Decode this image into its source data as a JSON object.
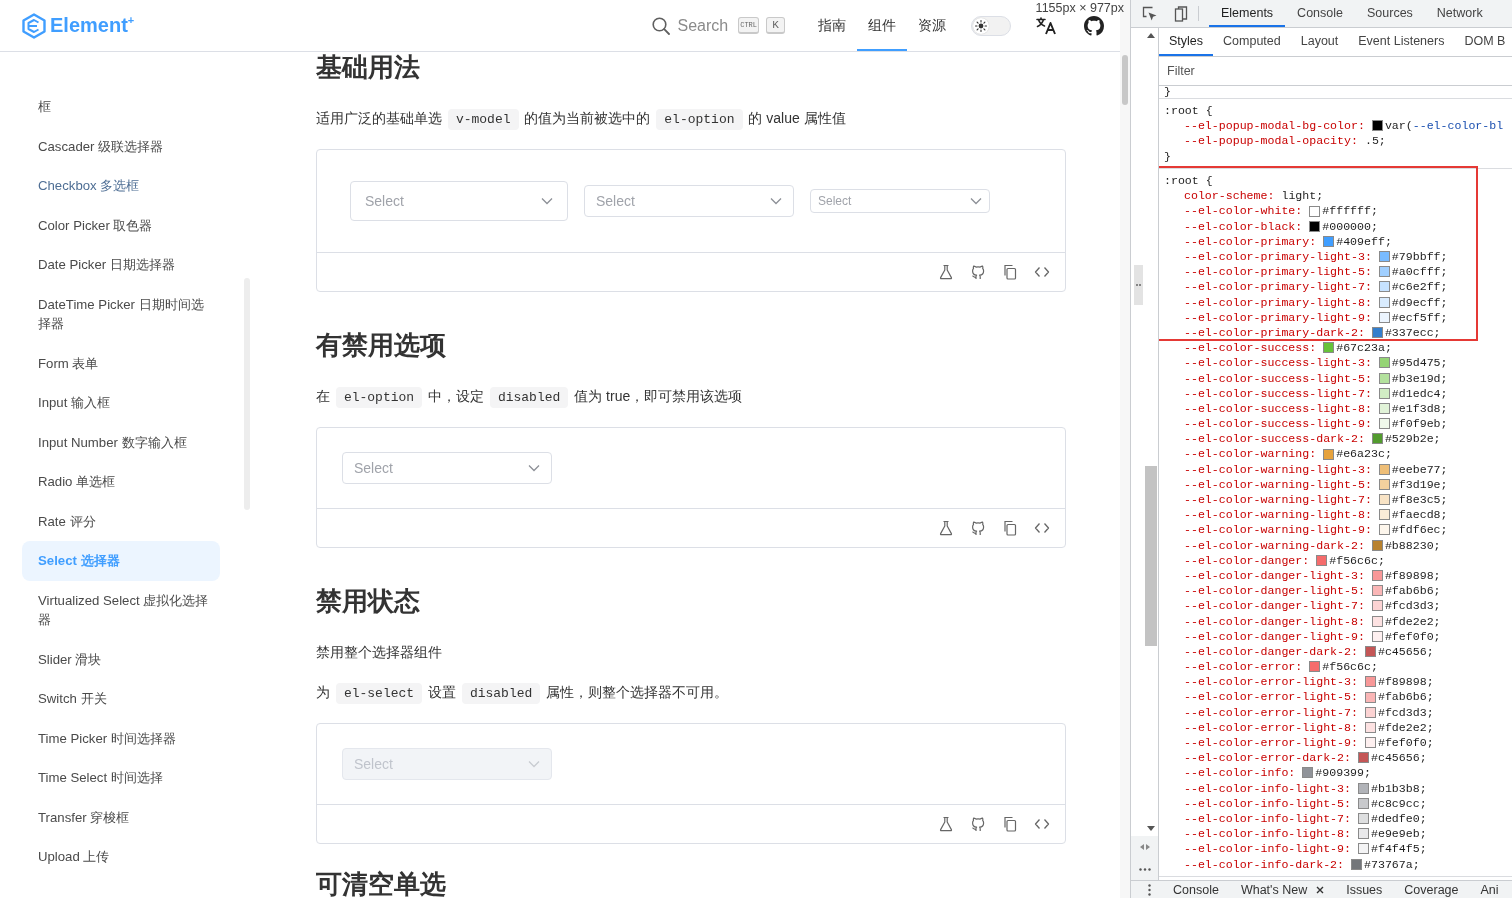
{
  "page": {
    "header": {
      "logo": "Element$^{+}$",
      "search": {
        "label": "Search",
        "keys": [
          "CTRL",
          "K"
        ]
      },
      "nav": [
        {
          "label": "指南",
          "selected": false
        },
        {
          "label": "组件",
          "selected": true
        },
        {
          "label": "资源",
          "selected": false
        }
      ],
      "theme_switch": {
        "on": false
      }
    },
    "viewport_size": "1155px × 977px",
    "sidebar": {
      "items": [
        {
          "label": "框",
          "selected": false,
          "hovered": false
        },
        {
          "label": "Cascader 级联选择器",
          "selected": false,
          "hovered": false
        },
        {
          "label": "Checkbox 多选框",
          "selected": false,
          "hovered": true
        },
        {
          "label": "Color Picker 取色器",
          "selected": false,
          "hovered": false
        },
        {
          "label": "Date Picker 日期选择器",
          "selected": false,
          "hovered": false
        },
        {
          "label": "DateTime Picker 日期时间选择器",
          "selected": false,
          "hovered": false
        },
        {
          "label": "Form 表单",
          "selected": false,
          "hovered": false
        },
        {
          "label": "Input 输入框",
          "selected": false,
          "hovered": false
        },
        {
          "label": "Input Number 数字输入框",
          "selected": false,
          "hovered": false
        },
        {
          "label": "Radio 单选框",
          "selected": false,
          "hovered": false
        },
        {
          "label": "Rate 评分",
          "selected": false,
          "hovered": false
        },
        {
          "label": "Select 选择器",
          "selected": true,
          "hovered": false
        },
        {
          "label": "Virtualized Select 虚拟化选择器",
          "selected": false,
          "hovered": false
        },
        {
          "label": "Slider 滑块",
          "selected": false,
          "hovered": false
        },
        {
          "label": "Switch 开关",
          "selected": false,
          "hovered": false
        },
        {
          "label": "Time Picker 时间选择器",
          "selected": false,
          "hovered": false
        },
        {
          "label": "Time Select 时间选择",
          "selected": false,
          "hovered": false
        },
        {
          "label": "Transfer 穿梭框",
          "selected": false,
          "hovered": false
        },
        {
          "label": "Upload 上传",
          "selected": false,
          "hovered": false
        }
      ]
    },
    "sections": [
      {
        "title": "基础用法",
        "paragraphs": [
          [
            {
              "kind": "text",
              "text": "适用广泛的基础单选 "
            },
            {
              "kind": "code",
              "text": "v-model"
            },
            {
              "kind": "text",
              "text": " 的值为当前被选中的 "
            },
            {
              "kind": "code",
              "text": "el-option"
            },
            {
              "kind": "text",
              "text": " 的 value 属性值"
            }
          ]
        ],
        "demo": {
          "selects": [
            {
              "kind": "large",
              "placeholder": "Select",
              "disabled": false
            },
            {
              "kind": "default",
              "placeholder": "Select",
              "disabled": false
            },
            {
              "kind": "small",
              "placeholder": "Select",
              "disabled": false
            }
          ]
        }
      },
      {
        "title": "有禁用选项",
        "paragraphs": [
          [
            {
              "kind": "text",
              "text": "在 "
            },
            {
              "kind": "code",
              "text": "el-option"
            },
            {
              "kind": "text",
              "text": " 中，设定 "
            },
            {
              "kind": "code",
              "text": "disabled"
            },
            {
              "kind": "text",
              "text": " 值为 true，即可禁用该选项"
            }
          ]
        ],
        "demo": {
          "selects": [
            {
              "kind": "default",
              "placeholder": "Select",
              "disabled": false
            }
          ]
        }
      },
      {
        "title": "禁用状态",
        "paragraphs": [
          [
            {
              "kind": "text",
              "text": "禁用整个选择器组件"
            }
          ],
          [
            {
              "kind": "text",
              "text": "为 "
            },
            {
              "kind": "code",
              "text": "el-select"
            },
            {
              "kind": "text",
              "text": " 设置 "
            },
            {
              "kind": "code",
              "text": "disabled"
            },
            {
              "kind": "text",
              "text": " 属性，则整个选择器不可用。"
            }
          ]
        ],
        "demo": {
          "selects": [
            {
              "kind": "default",
              "placeholder": "Select",
              "disabled": true
            }
          ]
        }
      },
      {
        "title": "可清空单选"
      }
    ]
  },
  "devtools": {
    "tabs": [
      {
        "label": "Elements",
        "selected": true
      },
      {
        "label": "Console",
        "selected": false
      },
      {
        "label": "Sources",
        "selected": false
      },
      {
        "label": "Network",
        "selected": false
      }
    ],
    "styles_tabs": [
      {
        "label": "Styles",
        "selected": true
      },
      {
        "label": "Computed",
        "selected": false
      },
      {
        "label": "Layout",
        "selected": false
      },
      {
        "label": "Event Listeners",
        "selected": false
      },
      {
        "label": "DOM B",
        "selected": false
      }
    ],
    "filter": {
      "placeholder": "Filter"
    },
    "rules": [
      {
        "groups": [
          {
            "boxed": false,
            "lines": [
              {
                "kind": "brace",
                "text": "}"
              }
            ]
          }
        ]
      },
      {
        "groups": [
          {
            "boxed": false,
            "lines": [
              {
                "kind": "selector",
                "text": ":root {"
              },
              {
                "kind": "declaration",
                "name": "--el-popup-modal-bg-color:",
                "value": "var(",
                "ref": "--el-color-bl",
                "color": "#000000"
              },
              {
                "kind": "declaration",
                "name": "--el-popup-modal-opacity:",
                "value": ".5;"
              },
              {
                "kind": "brace",
                "text": "}"
              }
            ]
          }
        ]
      },
      {
        "groups": [
          {
            "boxed": true,
            "lines": [
              {
                "kind": "selector",
                "text": ":root {"
              },
              {
                "kind": "declaration",
                "name": "color-scheme:",
                "value": "light;"
              },
              {
                "kind": "declaration",
                "name": "--el-color-white:",
                "value": "#ffffff;",
                "color": "#ffffff"
              },
              {
                "kind": "declaration",
                "name": "--el-color-black:",
                "value": "#000000;",
                "color": "#000000"
              },
              {
                "kind": "declaration",
                "name": "--el-color-primary:",
                "value": "#409eff;",
                "color": "#409eff"
              },
              {
                "kind": "declaration",
                "name": "--el-color-primary-light-3:",
                "value": "#79bbff;",
                "color": "#79bbff"
              },
              {
                "kind": "declaration",
                "name": "--el-color-primary-light-5:",
                "value": "#a0cfff;",
                "color": "#a0cfff"
              },
              {
                "kind": "declaration",
                "name": "--el-color-primary-light-7:",
                "value": "#c6e2ff;",
                "color": "#c6e2ff"
              },
              {
                "kind": "declaration",
                "name": "--el-color-primary-light-8:",
                "value": "#d9ecff;",
                "color": "#d9ecff"
              },
              {
                "kind": "declaration",
                "name": "--el-color-primary-light-9:",
                "value": "#ecf5ff;",
                "color": "#ecf5ff"
              },
              {
                "kind": "declaration",
                "name": "--el-color-primary-dark-2:",
                "value": "#337ecc;",
                "color": "#337ecc"
              }
            ]
          },
          {
            "boxed": false,
            "lines": [
              {
                "kind": "declaration",
                "name": "--el-color-success:",
                "value": "#67c23a;",
                "color": "#67c23a"
              },
              {
                "kind": "declaration",
                "name": "--el-color-success-light-3:",
                "value": "#95d475;",
                "color": "#95d475"
              },
              {
                "kind": "declaration",
                "name": "--el-color-success-light-5:",
                "value": "#b3e19d;",
                "color": "#b3e19d"
              },
              {
                "kind": "declaration",
                "name": "--el-color-success-light-7:",
                "value": "#d1edc4;",
                "color": "#d1edc4"
              },
              {
                "kind": "declaration",
                "name": "--el-color-success-light-8:",
                "value": "#e1f3d8;",
                "color": "#e1f3d8"
              },
              {
                "kind": "declaration",
                "name": "--el-color-success-light-9:",
                "value": "#f0f9eb;",
                "color": "#f0f9eb"
              },
              {
                "kind": "declaration",
                "name": "--el-color-success-dark-2:",
                "value": "#529b2e;",
                "color": "#529b2e"
              },
              {
                "kind": "declaration",
                "name": "--el-color-warning:",
                "value": "#e6a23c;",
                "color": "#e6a23c"
              },
              {
                "kind": "declaration",
                "name": "--el-color-warning-light-3:",
                "value": "#eebe77;",
                "color": "#eebe77"
              },
              {
                "kind": "declaration",
                "name": "--el-color-warning-light-5:",
                "value": "#f3d19e;",
                "color": "#f3d19e"
              },
              {
                "kind": "declaration",
                "name": "--el-color-warning-light-7:",
                "value": "#f8e3c5;",
                "color": "#f8e3c5"
              },
              {
                "kind": "declaration",
                "name": "--el-color-warning-light-8:",
                "value": "#faecd8;",
                "color": "#faecd8"
              },
              {
                "kind": "declaration",
                "name": "--el-color-warning-light-9:",
                "value": "#fdf6ec;",
                "color": "#fdf6ec"
              },
              {
                "kind": "declaration",
                "name": "--el-color-warning-dark-2:",
                "value": "#b88230;",
                "color": "#b88230"
              },
              {
                "kind": "declaration",
                "name": "--el-color-danger:",
                "value": "#f56c6c;",
                "color": "#f56c6c"
              },
              {
                "kind": "declaration",
                "name": "--el-color-danger-light-3:",
                "value": "#f89898;",
                "color": "#f89898"
              },
              {
                "kind": "declaration",
                "name": "--el-color-danger-light-5:",
                "value": "#fab6b6;",
                "color": "#fab6b6"
              },
              {
                "kind": "declaration",
                "name": "--el-color-danger-light-7:",
                "value": "#fcd3d3;",
                "color": "#fcd3d3"
              },
              {
                "kind": "declaration",
                "name": "--el-color-danger-light-8:",
                "value": "#fde2e2;",
                "color": "#fde2e2"
              },
              {
                "kind": "declaration",
                "name": "--el-color-danger-light-9:",
                "value": "#fef0f0;",
                "color": "#fef0f0"
              },
              {
                "kind": "declaration",
                "name": "--el-color-danger-dark-2:",
                "value": "#c45656;",
                "color": "#c45656"
              },
              {
                "kind": "declaration",
                "name": "--el-color-error:",
                "value": "#f56c6c;",
                "color": "#f56c6c"
              },
              {
                "kind": "declaration",
                "name": "--el-color-error-light-3:",
                "value": "#f89898;",
                "color": "#f89898"
              },
              {
                "kind": "declaration",
                "name": "--el-color-error-light-5:",
                "value": "#fab6b6;",
                "color": "#fab6b6"
              },
              {
                "kind": "declaration",
                "name": "--el-color-error-light-7:",
                "value": "#fcd3d3;",
                "color": "#fcd3d3"
              },
              {
                "kind": "declaration",
                "name": "--el-color-error-light-8:",
                "value": "#fde2e2;",
                "color": "#fde2e2"
              },
              {
                "kind": "declaration",
                "name": "--el-color-error-light-9:",
                "value": "#fef0f0;",
                "color": "#fef0f0"
              },
              {
                "kind": "declaration",
                "name": "--el-color-error-dark-2:",
                "value": "#c45656;",
                "color": "#c45656"
              },
              {
                "kind": "declaration",
                "name": "--el-color-info:",
                "value": "#909399;",
                "color": "#909399"
              },
              {
                "kind": "declaration",
                "name": "--el-color-info-light-3:",
                "value": "#b1b3b8;",
                "color": "#b1b3b8"
              },
              {
                "kind": "declaration",
                "name": "--el-color-info-light-5:",
                "value": "#c8c9cc;",
                "color": "#c8c9cc"
              },
              {
                "kind": "declaration",
                "name": "--el-color-info-light-7:",
                "value": "#dedfe0;",
                "color": "#dedfe0"
              },
              {
                "kind": "declaration",
                "name": "--el-color-info-light-8:",
                "value": "#e9e9eb;",
                "color": "#e9e9eb"
              },
              {
                "kind": "declaration",
                "name": "--el-color-info-light-9:",
                "value": "#f4f4f5;",
                "color": "#f4f4f5"
              },
              {
                "kind": "declaration",
                "name": "--el-color-info-dark-2:",
                "value": "#73767a;",
                "color": "#73767a"
              }
            ]
          }
        ]
      }
    ],
    "drawer_tabs": [
      {
        "label": "Console",
        "closable": false
      },
      {
        "label": "What's New",
        "closable": true
      },
      {
        "label": "Issues",
        "closable": false
      },
      {
        "label": "Coverage",
        "closable": false
      },
      {
        "label": "Ani",
        "closable": false
      }
    ]
  }
}
